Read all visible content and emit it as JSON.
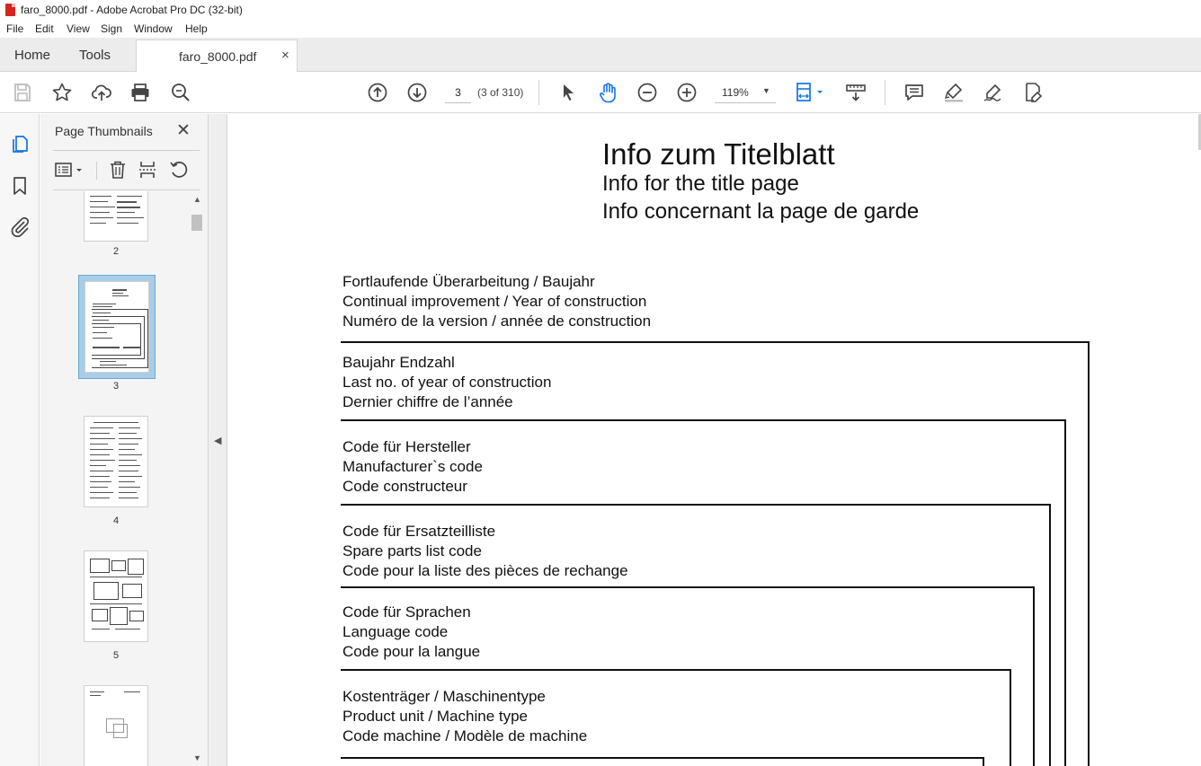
{
  "window": {
    "title": "faro_8000.pdf - Adobe Acrobat Pro DC (32-bit)"
  },
  "menu": [
    "File",
    "Edit",
    "View",
    "Sign",
    "Window",
    "Help"
  ],
  "tabs": {
    "home": "Home",
    "tools": "Tools",
    "document": "faro_8000.pdf",
    "close_glyph": "×"
  },
  "toolbar": {
    "page_input": "3",
    "page_count": "(3 of 310)",
    "zoom": "119%",
    "icons": [
      "save-icon",
      "bookmark-star-icon",
      "upload-icon",
      "print-icon",
      "search-zoom-icon",
      "prev-page-icon",
      "next-page-icon",
      "select-cursor-icon",
      "hand-tool-icon",
      "zoom-out-icon",
      "zoom-in-icon",
      "fit-page-icon",
      "scroll-mode-icon",
      "comment-icon",
      "highlight-icon",
      "sign-icon",
      "fill-sign-icon"
    ]
  },
  "left_rail": {
    "icons": [
      "page-thumbnails-icon",
      "bookmarks-icon",
      "attachments-icon"
    ]
  },
  "thumbnails_panel": {
    "title": "Page Thumbnails",
    "close_glyph": "✕",
    "pages": [
      "2",
      "3",
      "4",
      "5"
    ]
  },
  "document": {
    "title_de": "Info  zum  Titelblatt",
    "title_en": "Info for the title page",
    "title_fr": "Info concernant la page de garde",
    "blocks": [
      {
        "de": "Fortlaufende Überarbeitung / Baujahr",
        "en": "Continual improvement / Year of construction",
        "fr": "Numéro de la version / année de construction"
      },
      {
        "de": "Baujahr Endzahl",
        "en": "Last no. of year of construction",
        "fr": "Dernier chiffre de l’année"
      },
      {
        "de": "Code für Hersteller",
        "en": "Manufacturer`s  code",
        "fr": "Code constructeur"
      },
      {
        "de": "Code für Ersatzteilliste",
        "en": "Spare parts list code",
        "fr": "Code pour la liste des pièces de rechange"
      },
      {
        "de": "Code für Sprachen",
        "en": "Language code",
        "fr": "Code pour la langue"
      },
      {
        "de": "Kostenträger / Maschinentype",
        "en": "Product unit / Machine type",
        "fr": "Code machine / Modèle de machine"
      }
    ]
  }
}
